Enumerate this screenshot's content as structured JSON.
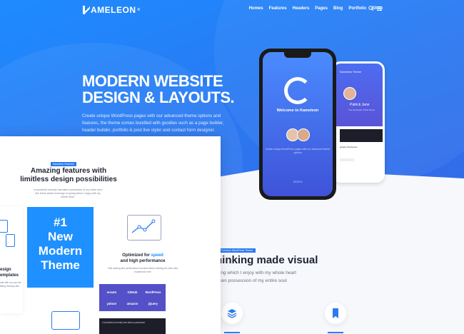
{
  "nav": {
    "logo": "AMELEON",
    "logo_mark": "K",
    "logo_sup": "®",
    "menu": [
      "Homes",
      "Features",
      "Headers",
      "Pages",
      "Blog",
      "Portfolio",
      "Shop"
    ]
  },
  "hero": {
    "headline_1": "MODERN WEBSITE",
    "headline_2": "DESIGN & LAYOUTS.",
    "text": "Create unique WordPress pages with our advanced theme options and features, the theme comes bundled with goodies such as a page builder, header builder, portfolio & post live styler and contact form designer."
  },
  "phone1": {
    "welcome": "Welcome to Kameleon",
    "small_text": "Create unique WordPress pages with our advanced theme options",
    "button": "DEMOS"
  },
  "phone2": {
    "title": "Kameleon Theme",
    "name": "Patrick Jane",
    "sub": "The developer of this theme",
    "lines": "Quality Wordpress"
  },
  "right_section": {
    "badge": "Premium WordPress Theme",
    "title": "hinking made visual",
    "text_1": "pring which I enjoy with my whole heart",
    "text_2": "taken possession of my entire soul"
  },
  "panel": {
    "badge": "Kameleon Features",
    "title_1": "Amazing features with",
    "title_2": "limitless design possibilities",
    "subtitle": "A wonderful serenity has taken possession of my entire soul like these sweet mornings of spring which I enjoy with my whole heart.",
    "left_title_1": "esign",
    "left_title_2": "emplates",
    "left_text": "ade with our you the fitting nessary skill",
    "blue_card": [
      "#1",
      "New",
      "Modern",
      "Theme"
    ],
    "speed_title_pre": "Optimized for ",
    "speed_title_blue": "speed",
    "speed_title_post": "and high performance",
    "speed_text": "Fast loading and performance focused theme building the best user experience ever",
    "logos": [
      "envato",
      "GitHub",
      "WordPress",
      "yahoo!",
      "amazon",
      "jQuery"
    ],
    "dark_text": "A wonderful serenity has taken possession"
  }
}
